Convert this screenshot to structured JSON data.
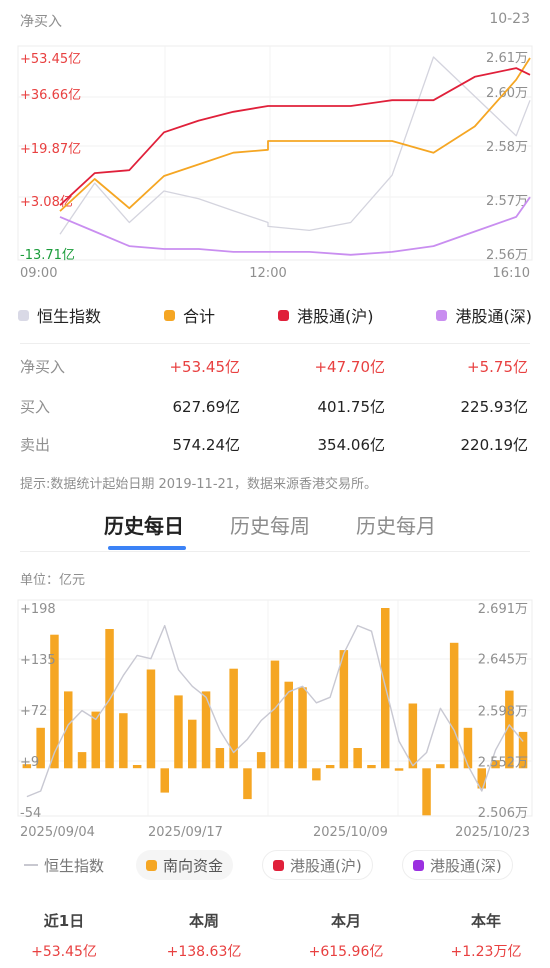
{
  "intraday": {
    "title": "净买入",
    "date": "10-23",
    "left_labels": [
      "+53.45亿",
      "+36.66亿",
      "+19.87亿",
      "+3.08亿",
      "-13.71亿"
    ],
    "right_labels": [
      "2.61万",
      "2.60万",
      "2.58万",
      "2.57万",
      "2.56万"
    ],
    "x_labels": [
      "09:00",
      "12:00",
      "16:10"
    ],
    "legend": [
      {
        "label": "恒生指数",
        "color": "#d9d9e6"
      },
      {
        "label": "合计",
        "color": "#f5a623"
      },
      {
        "label": "港股通(沪)",
        "color": "#e0203a"
      },
      {
        "label": "港股通(深)",
        "color": "#c98ef0"
      }
    ]
  },
  "summary": {
    "rows": [
      {
        "label": "净买入",
        "v1": "+53.45亿",
        "v2": "+47.70亿",
        "v3": "+5.75亿"
      },
      {
        "label": "买入",
        "v1": "627.69亿",
        "v2": "401.75亿",
        "v3": "225.93亿"
      },
      {
        "label": "卖出",
        "v1": "574.24亿",
        "v2": "354.06亿",
        "v3": "220.19亿"
      }
    ],
    "note": "提示:数据统计起始日期 2019-11-21，数据来源香港交易所。"
  },
  "tabs": [
    "历史每日",
    "历史每周",
    "历史每月"
  ],
  "history": {
    "unit": "单位：亿元",
    "left_labels": [
      "+198",
      "+135",
      "+72",
      "+9",
      "-54"
    ],
    "right_labels": [
      "2.691万",
      "2.645万",
      "2.598万",
      "2.552万",
      "2.506万"
    ],
    "x_labels": [
      "2025/09/04",
      "2025/09/17",
      "2025/10/09",
      "2025/10/23"
    ],
    "chips": [
      {
        "label": "恒生指数",
        "color": "#c8c8d0"
      },
      {
        "label": "南向资金",
        "color": "#f5a623"
      },
      {
        "label": "港股通(沪)",
        "color": "#e0203a"
      },
      {
        "label": "港股通(深)",
        "color": "#9b30e0"
      }
    ]
  },
  "stats": [
    {
      "label": "近1日",
      "value": "+53.45亿"
    },
    {
      "label": "本周",
      "value": "+138.63亿"
    },
    {
      "label": "本月",
      "value": "+615.96亿"
    },
    {
      "label": "本年",
      "value": "+1.23万亿"
    }
  ],
  "chart_data": [
    {
      "type": "line",
      "x": [
        "09:00",
        "09:30",
        "10:00",
        "10:30",
        "11:00",
        "11:30",
        "12:00",
        "13:00",
        "13:30",
        "14:00",
        "14:30",
        "15:00",
        "15:30",
        "16:00",
        "16:10"
      ],
      "y_left_range": [
        -13.71,
        53.45
      ],
      "y_right_range": [
        2.56,
        2.61
      ],
      "series": [
        {
          "name": "合计",
          "values": [
            1,
            12,
            2,
            13,
            17,
            21,
            22,
            25,
            25,
            25,
            25,
            21,
            30,
            46,
            53.45
          ]
        },
        {
          "name": "港股通(沪)",
          "values": [
            3,
            14,
            15,
            28,
            32,
            35,
            37,
            37,
            37,
            37,
            39,
            39,
            47,
            50,
            47.7
          ]
        },
        {
          "name": "港股通(深)",
          "values": [
            -1,
            -6,
            -11,
            -12,
            -12,
            -13,
            -13,
            -13,
            -13,
            -14,
            -13,
            -11,
            -6,
            -1,
            5.75
          ]
        },
        {
          "name": "恒生指数",
          "values": [
            2.565,
            2.578,
            2.568,
            2.576,
            2.574,
            2.571,
            2.568,
            2.567,
            2.566,
            2.568,
            2.58,
            2.61,
            2.6,
            2.59,
            2.599
          ]
        }
      ]
    },
    {
      "type": "bar",
      "x_labels": [
        "2025/09/04",
        "2025/09/17",
        "2025/10/09",
        "2025/10/23"
      ],
      "y_left_range": [
        -54,
        198
      ],
      "y_right_range": [
        2.506,
        2.691
      ],
      "series": [
        {
          "name": "南向资金",
          "values": [
            5,
            50,
            165,
            95,
            20,
            70,
            172,
            68,
            4,
            122,
            -30,
            90,
            60,
            95,
            25,
            123,
            -38,
            20,
            133,
            107,
            100,
            -15,
            4,
            146,
            25,
            4,
            198,
            -3,
            80,
            -58,
            5,
            155,
            50,
            -25,
            10,
            96,
            45
          ]
        },
        {
          "name": "恒生指数",
          "values": [
            2.52,
            2.525,
            2.56,
            2.585,
            2.598,
            2.59,
            2.608,
            2.63,
            2.648,
            2.645,
            2.675,
            2.635,
            2.62,
            2.61,
            2.58,
            2.56,
            2.572,
            2.589,
            2.6,
            2.615,
            2.62,
            2.605,
            2.61,
            2.65,
            2.675,
            2.67,
            2.62,
            2.57,
            2.548,
            2.56,
            2.6,
            2.58,
            2.548,
            2.525,
            2.562,
            2.585,
            2.57
          ]
        }
      ]
    }
  ]
}
